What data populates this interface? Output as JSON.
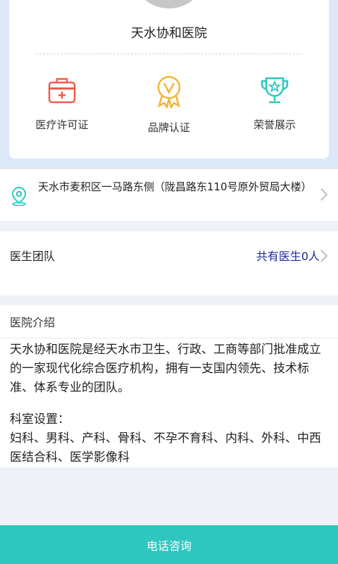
{
  "hospital": {
    "name": "天水协和医院"
  },
  "features": [
    {
      "label": "医疗许可证",
      "icon": "medical-kit-icon"
    },
    {
      "label": "品牌认证",
      "icon": "brand-medal-icon"
    },
    {
      "label": "荣誉展示",
      "icon": "trophy-icon"
    }
  ],
  "address": {
    "text": "天水市麦积区一马路东侧（陇昌路东110号原外贸局大楼）",
    "icon": "location-pin-icon"
  },
  "team": {
    "title": "医生团队",
    "count_label": "共有医生0人"
  },
  "intro": {
    "title": "医院介绍",
    "body": "天水协和医院是经天水市卫生、行政、工商等部门批准成立的一家现代化综合医疗机构，拥有一支国内领先、技术标准、体系专业的团队。",
    "departments_title": "科室设置：",
    "departments": "妇科、男科、产科、骨科、不孕不育科、内科、外科、中西医结合科、医学影像科"
  },
  "actions": {
    "call_label": "电话咨询"
  },
  "colors": {
    "accent": "#2ec7bf",
    "link": "#1a2a9c",
    "icon_red": "#ef5b4c",
    "icon_gold": "#f2b53a",
    "icon_teal": "#2ec7bf"
  }
}
